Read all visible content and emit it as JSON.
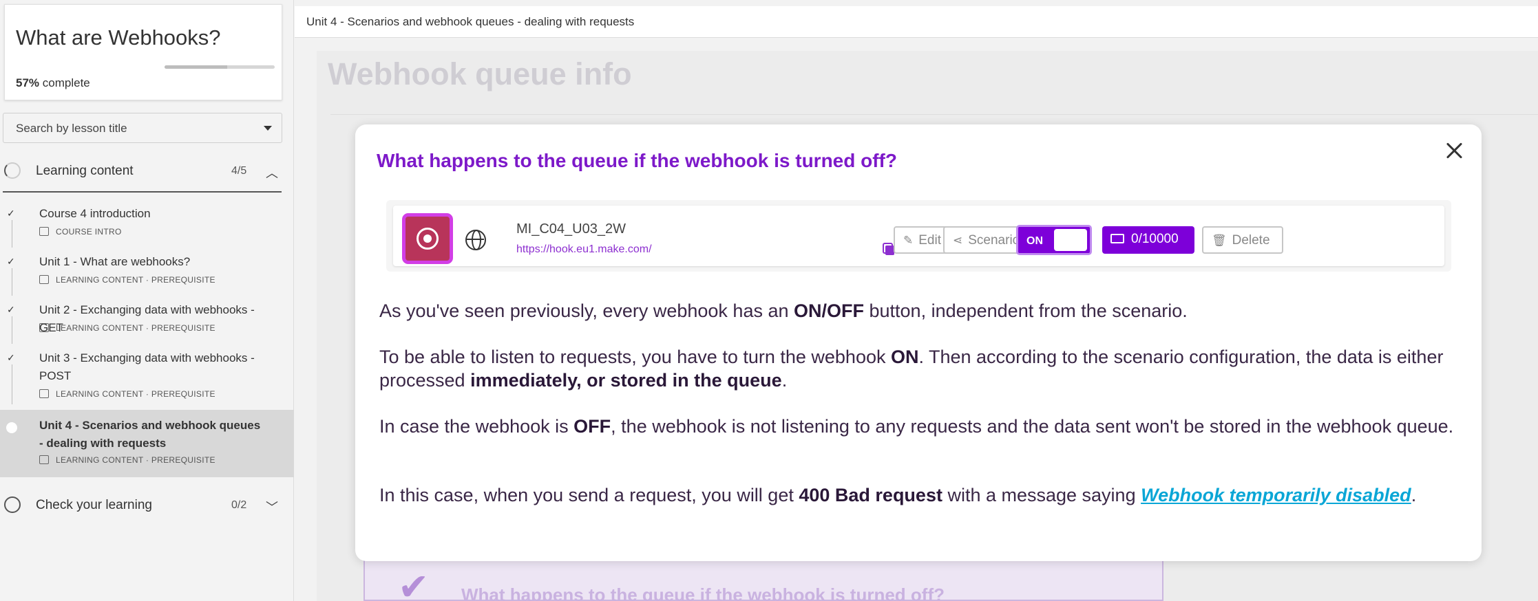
{
  "sidebar": {
    "course_title": "What are Webhooks?",
    "progress_percent": "57%",
    "progress_suffix": "complete",
    "progress_value": 0.57,
    "search_placeholder": "Search by lesson title",
    "sections": [
      {
        "label": "Learning content",
        "count": "4/5",
        "chevron": "^"
      },
      {
        "label": "Check your learning",
        "count": "0/2",
        "chevron": "v"
      }
    ],
    "lessons": [
      {
        "title": "Course 4 introduction",
        "meta": "COURSE INTRO",
        "status": "✓"
      },
      {
        "title": "Unit 1 - What are webhooks?",
        "meta": "LEARNING CONTENT · PREREQUISITE",
        "status": "✓"
      },
      {
        "title": "Unit 2 - Exchanging data with webhooks - GET",
        "meta": "LEARNING CONTENT · PREREQUISITE",
        "status": "✓"
      },
      {
        "title": "Unit 3 - Exchanging data with webhooks - POST",
        "meta": "LEARNING CONTENT · PREREQUISITE",
        "status": "✓"
      },
      {
        "title": "Unit 4 - Scenarios and webhook queues - dealing with requests",
        "meta": "LEARNING CONTENT · PREREQUISITE",
        "status": ""
      }
    ]
  },
  "main": {
    "breadcrumb": "Unit 4 - Scenarios and webhook queues - dealing with requests",
    "page_heading": "Webhook queue info",
    "background_card_text": "What happens to the queue if the webhook is turned off?"
  },
  "modal": {
    "question": "What happens to the queue if the webhook is turned off?",
    "webhook": {
      "name": "MI_C04_U03_2W",
      "url": "https://hook.eu1.make.com/",
      "edit_label": "Edit",
      "scenario_label": "Scenario",
      "toggle_label": "ON",
      "queue_label": "0/10000",
      "delete_label": "Delete"
    },
    "p1": {
      "a": "As you've seen previously, every webhook has an ",
      "b": "ON/OFF",
      "c": " button, independent from the scenario."
    },
    "p2": {
      "a": "To be able to listen to requests, you have to turn the webhook ",
      "b": "ON",
      "c": ". Then according to the scenario configuration, the data is either processed ",
      "d": "immediately",
      "e": ", or stored in the queue",
      "f": "."
    },
    "p3": {
      "a": "In case the webhook is ",
      "b": "OFF",
      "c": ", the webhook is not listening to any requests and the data sent won't be stored in the webhook queue."
    },
    "p4": {
      "a": "In this case, when you send a request, you will get ",
      "b": "400 Bad request",
      "c": " with a message saying ",
      "link": "Webhook temporarily disabled",
      "d": "."
    }
  },
  "colors": {
    "accent": "#7d00d9",
    "heading_purple": "#7d19c9",
    "link": "#0aa6d6",
    "icon_border": "#d23ee6"
  }
}
